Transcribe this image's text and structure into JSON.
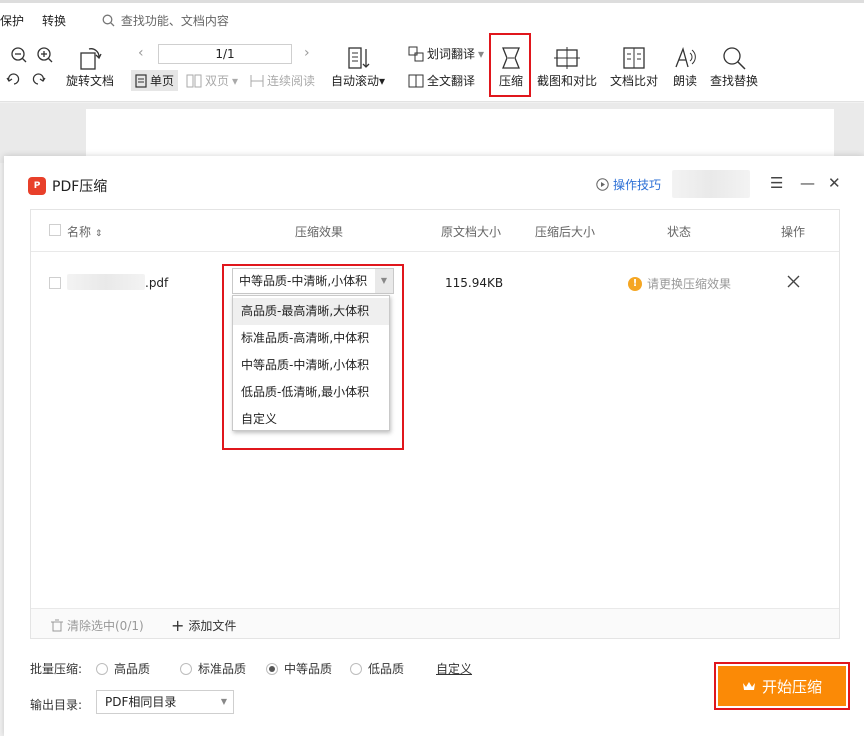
{
  "menubar": {
    "item_protect": "保护",
    "item_convert": "转换",
    "search_placeholder": "查找功能、文档内容"
  },
  "toolbar": {
    "rotate_label": "旋转文档",
    "page_value": "1/1",
    "single_page": "单页",
    "double_page": "双页",
    "continuous": "连续阅读",
    "auto_scroll": "自动滚动",
    "word_translate": "划词翻译",
    "full_translate": "全文翻译",
    "compress": "压缩",
    "screenshot_compare": "截图和对比",
    "doc_compare": "文档比对",
    "read_aloud": "朗读",
    "find_replace": "查找替换"
  },
  "dialog": {
    "logo_text": "P",
    "title": "PDF压缩",
    "tips": "操作技巧",
    "columns": [
      "名称",
      "压缩效果",
      "原文档大小",
      "压缩后大小",
      "状态",
      "操作"
    ],
    "row": {
      "filename_suffix": ".pdf",
      "selected_quality": "中等品质-中清晰,小体积",
      "original_size": "115.94KB",
      "compressed_size": "",
      "status": "请更换压缩效果"
    },
    "dropdown_options": [
      "高品质-最高清晰,大体积",
      "标准品质-高清晰,中体积",
      "中等品质-中清晰,小体积",
      "低品质-低清晰,最小体积",
      "自定义"
    ],
    "clear_selected": "清除选中(0/1)",
    "add_file": "添加文件",
    "batch_label": "批量压缩:",
    "batch_options": [
      "高品质",
      "标准品质",
      "中等品质",
      "低品质"
    ],
    "batch_selected_index": 2,
    "custom_link": "自定义",
    "output_label": "输出目录:",
    "output_value": "PDF相同目录",
    "start_button": "开始压缩"
  },
  "colors": {
    "accent_orange": "#fb8a06",
    "highlight_red": "#e0161c",
    "link_blue": "#2b6fd6",
    "warning": "#f5a623"
  }
}
